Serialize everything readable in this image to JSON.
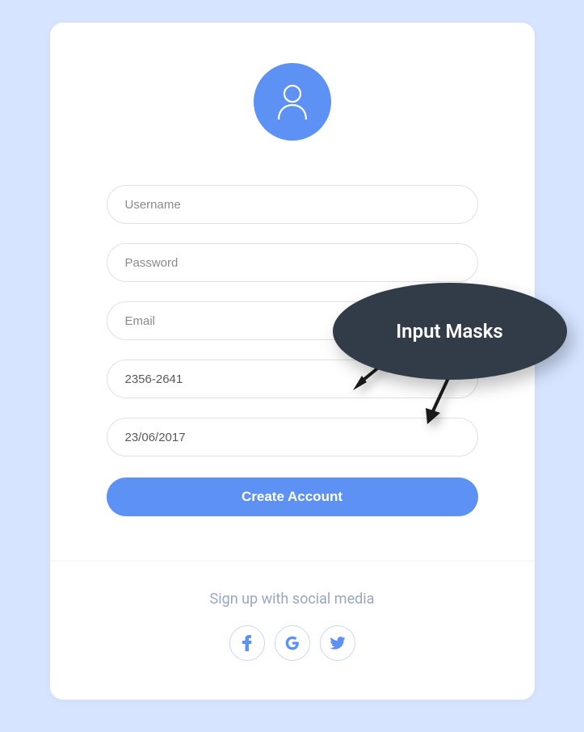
{
  "form": {
    "username_placeholder": "Username",
    "password_placeholder": "Password",
    "email_placeholder": "Email",
    "code_value": "2356-2641",
    "date_value": "23/06/2017",
    "submit_label": "Create Account"
  },
  "social": {
    "text": "Sign up with social media"
  },
  "callout": {
    "label": "Input Masks"
  },
  "colors": {
    "primary": "#5d92f4",
    "background": "#d6e4ff",
    "callout_bg": "#323c48"
  }
}
